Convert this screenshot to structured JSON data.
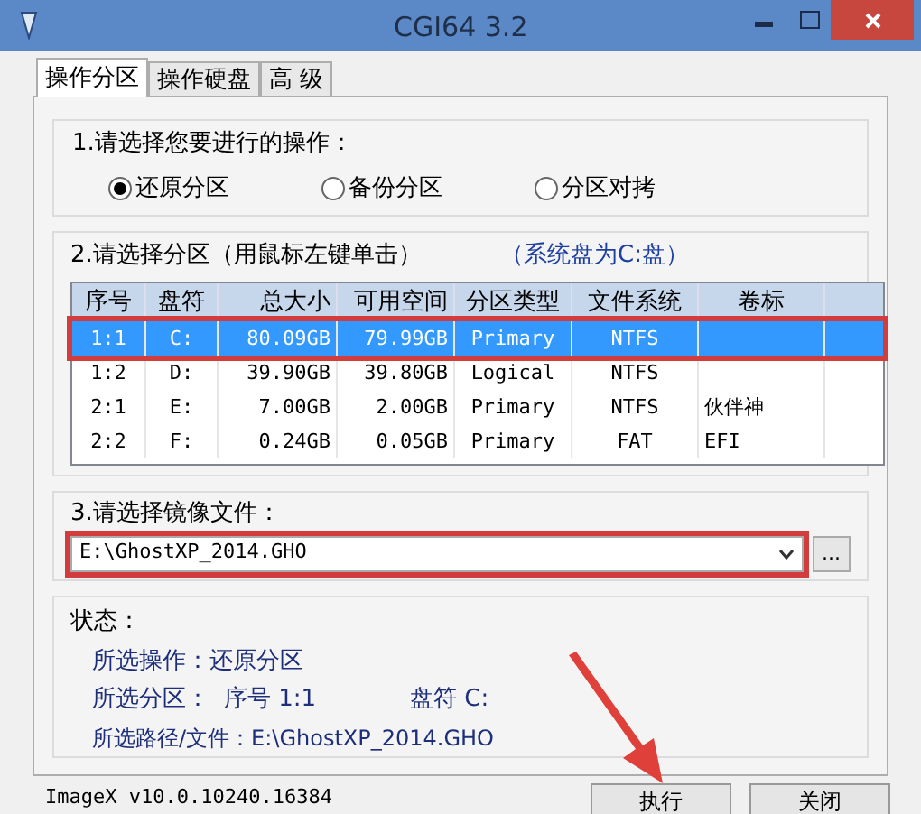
{
  "window": {
    "title": "CGI64  3.2"
  },
  "tabs": [
    {
      "label": "操作分区",
      "selected": true
    },
    {
      "label": "操作硬盘",
      "selected": false
    },
    {
      "label": "高 级",
      "selected": false
    }
  ],
  "operation": {
    "heading": "1.请选择您要进行的操作：",
    "options": [
      {
        "label": "还原分区",
        "selected": true
      },
      {
        "label": "备份分区",
        "selected": false
      },
      {
        "label": "分区对拷",
        "selected": false
      }
    ]
  },
  "partitions": {
    "heading": "2.请选择分区（用鼠标左键单击）",
    "note": "（系统盘为C:盘）",
    "columns": [
      "序号",
      "盘符",
      "总大小",
      "可用空间",
      "分区类型",
      "文件系统",
      "卷标"
    ],
    "rows": [
      {
        "cells": [
          "1:1",
          "C:",
          "80.09GB",
          "79.99GB",
          "Primary",
          "NTFS",
          ""
        ],
        "selected": true,
        "highlighted": true
      },
      {
        "cells": [
          "1:2",
          "D:",
          "39.90GB",
          "39.80GB",
          "Logical",
          "NTFS",
          ""
        ],
        "selected": false,
        "highlighted": false
      },
      {
        "cells": [
          "2:1",
          "E:",
          "7.00GB",
          "2.00GB",
          "Primary",
          "NTFS",
          "伙伴神"
        ],
        "selected": false,
        "highlighted": false
      },
      {
        "cells": [
          "2:2",
          "F:",
          "0.24GB",
          "0.05GB",
          "Primary",
          "FAT",
          "EFI"
        ],
        "selected": false,
        "highlighted": false
      }
    ]
  },
  "image_file": {
    "heading": "3.请选择镜像文件：",
    "value": "E:\\GhostXP_2014.GHO",
    "browse": "...",
    "highlighted": true
  },
  "status": {
    "heading": "状态：",
    "operation": "所选操作：还原分区",
    "partition_label": "所选分区：",
    "index": "序号 1:1",
    "drive": "盘符 C:",
    "path": "所选路径/文件：E:\\GhostXP_2014.GHO"
  },
  "version": "ImageX v10.0.10240.16384",
  "buttons": [
    "执行",
    "关闭"
  ]
}
